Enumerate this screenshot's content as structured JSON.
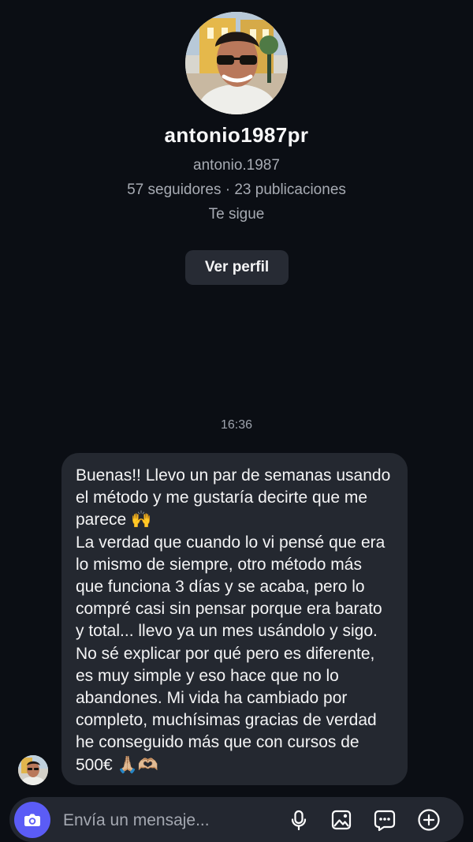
{
  "profile": {
    "username": "antonio1987pr",
    "handle": "antonio.1987",
    "stats": "57 seguidores · 23 publicaciones",
    "follows_you": "Te sigue",
    "view_profile_label": "Ver perfil"
  },
  "conversation": {
    "timestamp": "16:36",
    "message": "Buenas!! Llevo un par de semanas usando el método y me gustaría decirte que me parece 🙌\nLa verdad que cuando lo vi pensé que era lo mismo de siempre, otro método más que funciona 3 días y se acaba, pero lo compré casi sin pensar porque era barato y total... llevo ya un mes usándolo y sigo. No sé explicar por qué pero es diferente, es muy simple y eso hace que no lo abandones. Mi vida ha cambiado por completo, muchísimas gracias de verdad he conseguido más que con cursos de 500€  🙏🏼🫶🏼"
  },
  "composer": {
    "placeholder": "Envía un mensaje...",
    "icons": [
      "camera-icon",
      "microphone-icon",
      "image-gallery-icon",
      "sticker-message-icon",
      "add-icon"
    ]
  },
  "colors": {
    "background": "#0b0e14",
    "bubble": "#242830",
    "button": "#272b34",
    "camera_accent": "#5b5cf6"
  }
}
